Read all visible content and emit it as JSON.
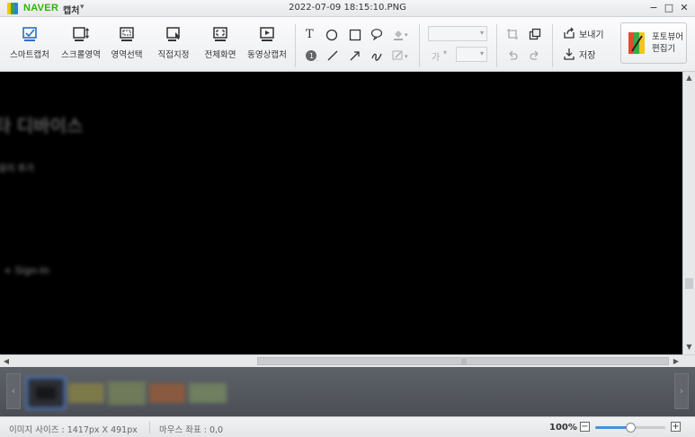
{
  "titlebar": {
    "brand": "NAVER",
    "app_name": "캡처",
    "app_caret": "▾",
    "title": "2022-07-09 18:15:10.PNG",
    "minimize": "−",
    "maximize": "□",
    "close": "✕"
  },
  "toolbar": {
    "capture_buttons": [
      {
        "label": "스마트캡처",
        "icon": "smart-capture-icon"
      },
      {
        "label": "스크롤영역",
        "icon": "scroll-area-icon"
      },
      {
        "label": "영역선택",
        "icon": "area-select-icon"
      },
      {
        "label": "직접지정",
        "icon": "direct-select-icon"
      },
      {
        "label": "전체화면",
        "icon": "fullscreen-icon"
      },
      {
        "label": "동영상캡처",
        "icon": "video-capture-icon"
      }
    ],
    "text_tool": "T",
    "font_size_label": "가",
    "send_label": "보내기",
    "save_label": "저장",
    "editor_label_1": "포토뷰어",
    "editor_label_2": "편집기"
  },
  "canvas": {
    "blur_line_1": "타 디바이스",
    "blur_line_2": "알리 추가",
    "blur_line_3": "+ Sign-In"
  },
  "scrollbars": {
    "up": "▲",
    "down": "▼",
    "left": "◀",
    "right": "▶",
    "grip": "|||"
  },
  "strip": {
    "prev": "‹",
    "next": "›"
  },
  "status": {
    "image_size": "이미지 사이즈 : 1417px X 491px",
    "mouse_coords": "마우스 좌표 : 0,0",
    "zoom": "100%",
    "zoom_level": 0.5,
    "zoom_out": "−",
    "zoom_in": "+"
  },
  "colors": {
    "brand_green": "#2db400",
    "canvas_bg": "#000000",
    "strip_bg": "#52565c",
    "accent_blue": "#4a90d9"
  }
}
